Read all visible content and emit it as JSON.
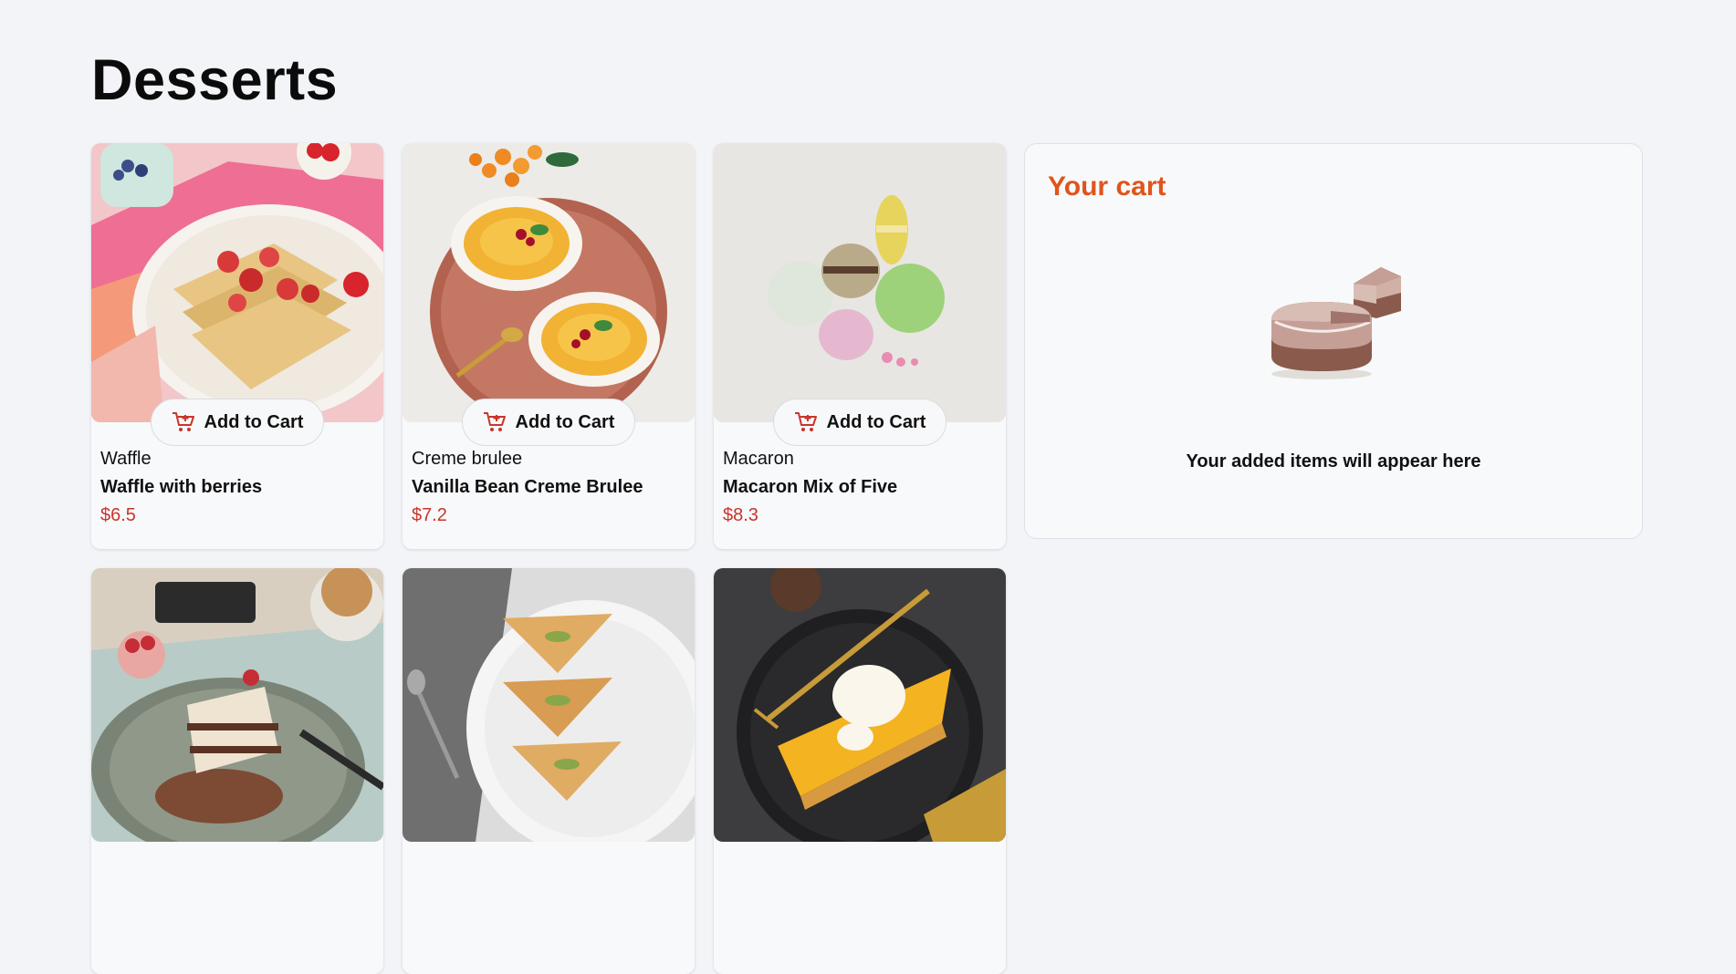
{
  "page": {
    "title": "Desserts"
  },
  "products": [
    {
      "category": "Waffle",
      "name": "Waffle with berries",
      "price": "$6.5",
      "button_label": "Add to Cart"
    },
    {
      "category": "Creme brulee",
      "name": "Vanilla Bean Creme Brulee",
      "price": "$7.2",
      "button_label": "Add to Cart"
    },
    {
      "category": "Macaron",
      "name": "Macaron Mix of Five",
      "price": "$8.3",
      "button_label": "Add to Cart"
    }
  ],
  "cart": {
    "title": "Your cart",
    "empty_message": "Your added items will appear here",
    "illustration_icon": "empty-cake-icon"
  },
  "colors": {
    "accent": "#e0541c",
    "price": "#c8352b",
    "background": "#f2f4f8"
  },
  "icons": {
    "add_to_cart": "cart-plus-icon"
  }
}
